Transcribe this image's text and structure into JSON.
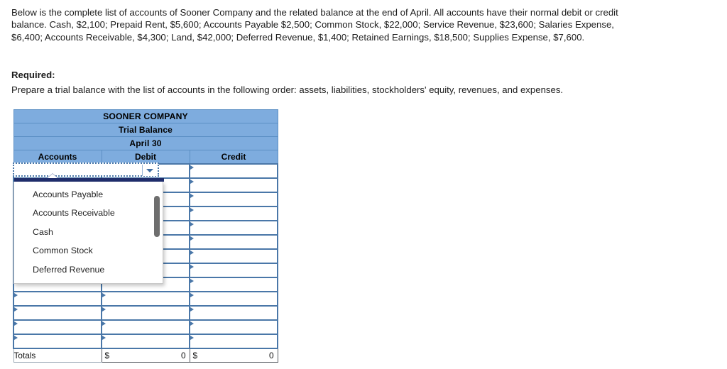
{
  "problem": {
    "statement": "Below is the complete list of accounts of Sooner Company and the related balance at the end of April. All accounts have their normal debit or credit balance. Cash, $2,100; Prepaid Rent, $5,600; Accounts Payable $2,500; Common Stock, $22,000; Service Revenue, $23,600; Salaries Expense, $6,400; Accounts Receivable, $4,300; Land, $42,000; Deferred Revenue, $1,400; Retained Earnings, $18,500; Supplies Expense, $7,600.",
    "required_label": "Required:",
    "required_text": "Prepare a trial balance with the list of accounts in the following order: assets, liabilities, stockholders' equity, revenues, and expenses."
  },
  "worksheet": {
    "title_company": "SOONER COMPANY",
    "title_statement": "Trial Balance",
    "title_date": "April 30",
    "columns": {
      "accounts": "Accounts",
      "debit": "Debit",
      "credit": "Credit"
    },
    "row_count": 13,
    "rows": [
      {
        "account": "",
        "debit": "",
        "credit": ""
      },
      {
        "account": "",
        "debit": "",
        "credit": ""
      },
      {
        "account": "",
        "debit": "",
        "credit": ""
      },
      {
        "account": "",
        "debit": "",
        "credit": ""
      },
      {
        "account": "",
        "debit": "",
        "credit": ""
      },
      {
        "account": "",
        "debit": "",
        "credit": ""
      },
      {
        "account": "",
        "debit": "",
        "credit": ""
      },
      {
        "account": "",
        "debit": "",
        "credit": ""
      },
      {
        "account": "",
        "debit": "",
        "credit": ""
      },
      {
        "account": "",
        "debit": "",
        "credit": ""
      },
      {
        "account": "",
        "debit": "",
        "credit": ""
      },
      {
        "account": "",
        "debit": "",
        "credit": ""
      },
      {
        "account": "",
        "debit": "",
        "credit": ""
      }
    ],
    "totals": {
      "label": "Totals",
      "debit_currency": "$",
      "debit_value": "0",
      "credit_currency": "$",
      "credit_value": "0"
    }
  },
  "account_select": {
    "value": "",
    "placeholder": "",
    "expanded": true,
    "options": [
      "Accounts Payable",
      "Accounts Receivable",
      "Cash",
      "Common Stock",
      "Deferred Revenue"
    ]
  },
  "colors": {
    "header_blue": "#7EACDE",
    "cell_border_blue": "#4A77A8",
    "dropdown_topbar": "#1F2D6B",
    "scrollbar_thumb": "#6E6E6E"
  }
}
